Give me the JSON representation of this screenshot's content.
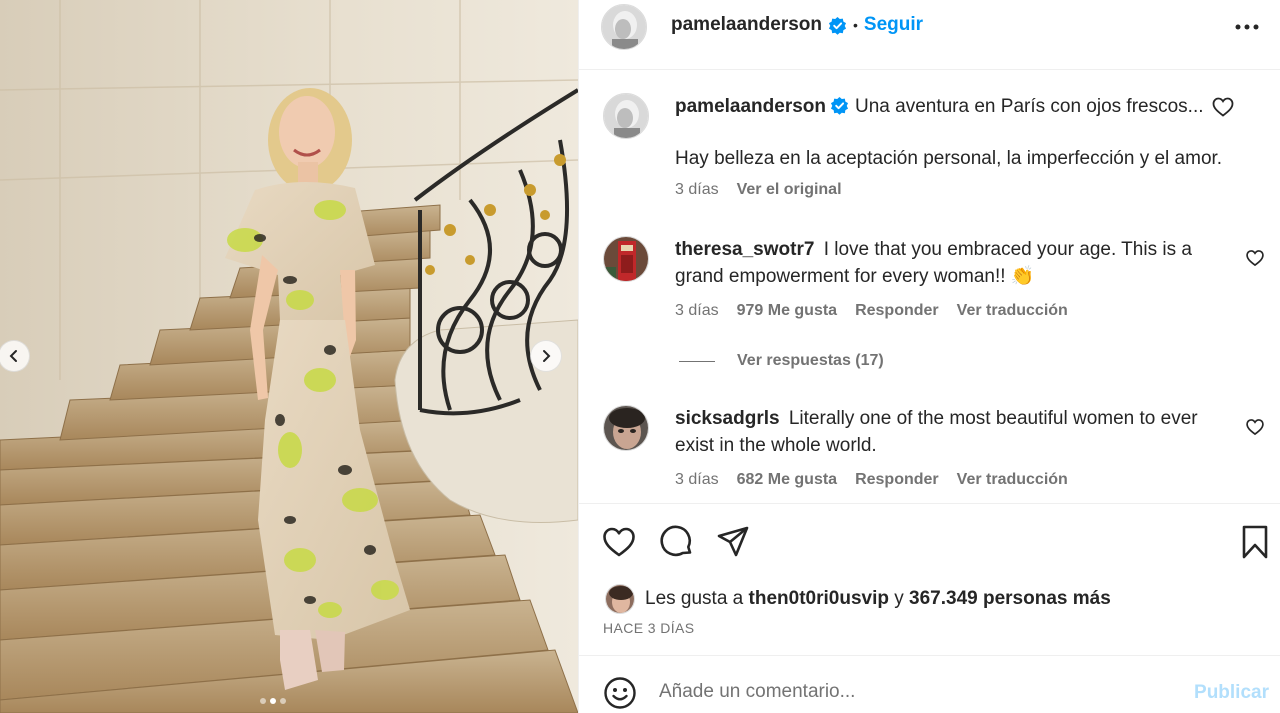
{
  "post": {
    "author": "pamelaanderson",
    "follow_label": "Seguir",
    "separator": "•"
  },
  "caption": {
    "username": "pamelaanderson",
    "title": "Una aventura en París con ojos frescos...",
    "body": "Hay belleza en la aceptación personal, la imperfección y el amor.",
    "time": "3 días",
    "see_original": "Ver el original"
  },
  "comments": [
    {
      "username": "theresa_swotr7",
      "text": "I love that you embraced your age. This is a grand empowerment for every woman!! 👏",
      "time": "3 días",
      "likes": "979 Me gusta",
      "reply": "Responder",
      "translate": "Ver traducción",
      "view_replies": "Ver respuestas (17)"
    },
    {
      "username": "sicksadgrls",
      "text": "Literally one of the most beautiful women to ever exist in the whole world.",
      "time": "3 días",
      "likes": "682 Me gusta",
      "reply": "Responder",
      "translate": "Ver traducción"
    }
  ],
  "likes_summary": {
    "prefix": "Les gusta a",
    "user": "then0t0ri0usvip",
    "joiner": "y",
    "others": "367.349 personas más"
  },
  "time_ago": "HACE 3 DÍAS",
  "composer": {
    "placeholder": "Añade un comentario...",
    "publish": "Publicar"
  },
  "carousel": {
    "slide_count": 3,
    "active_slide": 2
  },
  "colors": {
    "accent": "#0095f6",
    "publish_disabled": "#b2dffc",
    "secondary_text": "#737373"
  },
  "icons": [
    "verified-badge-icon",
    "more-options-icon",
    "heart-icon",
    "comment-icon",
    "share-icon",
    "bookmark-icon",
    "emoji-icon",
    "chevron-left-icon",
    "chevron-right-icon"
  ]
}
